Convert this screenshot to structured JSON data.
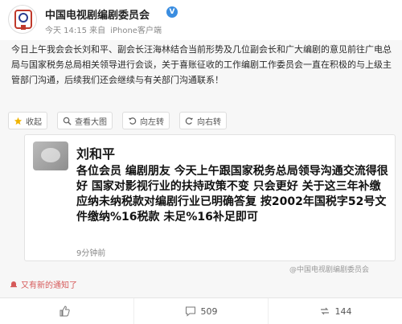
{
  "post": {
    "account_name": "中国电视剧编剧委员会",
    "verified_mark": "V",
    "timestamp": "今天 14:15 来自",
    "client": "iPhone客户端",
    "text": "今日上午我会会长刘和平、副会长汪海林结合当前形势及几位副会长和广大编剧的意见前往广电总局与国家税务总局相关领导进行会谈，关于喜账征收的工作编剧工作委员会一直在积极的与上级主管部门沟通，后续我们还会继续与有关部门沟通联系！"
  },
  "actions": {
    "favorite_label": "收起",
    "view_image_label": "查看大图",
    "rotate_left_label": "向左转",
    "rotate_right_label": "向右转"
  },
  "repost": {
    "author": "刘和平",
    "text": "各位会员 编剧朋友 今天上午跟国家税务总局领导沟通交流得很好 国家对影视行业的扶持政策不变 只会更好 关于这三年补缴应纳未纳税款对编剧行业已明确答复 按2002年国税字52号文件缴纳%16税款 未足%16补足即可",
    "time": "9分钟前"
  },
  "watermark": "@中国电视剧编剧委员会",
  "notice": "又有新的通知了",
  "stats": {
    "likes": "",
    "comments": "509",
    "reposts": "144"
  },
  "colors": {
    "verified": "#3a8de0",
    "notice": "#d65a5a"
  },
  "icons": [
    "broadcast-logo-icon",
    "verified-icon",
    "star-icon",
    "magnifier-icon",
    "rotate-left-icon",
    "rotate-right-icon",
    "bell-icon",
    "thumb-up-icon",
    "comment-icon",
    "repost-icon"
  ]
}
